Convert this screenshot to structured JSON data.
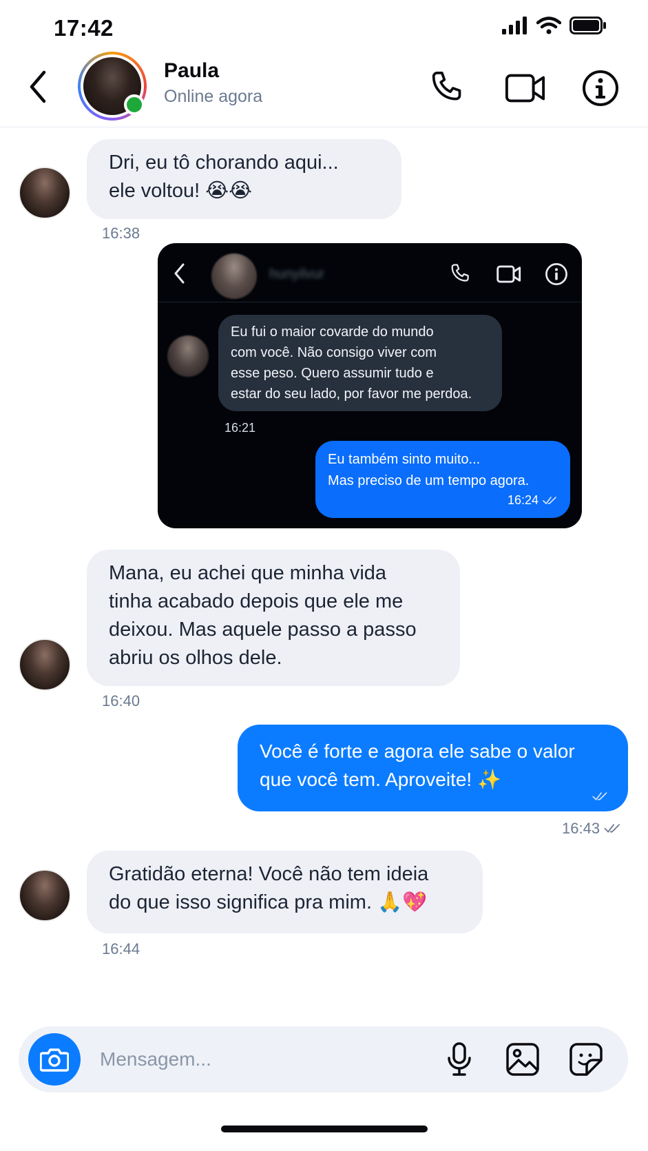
{
  "status_bar": {
    "time": "17:42"
  },
  "header": {
    "contact_name": "Paula",
    "contact_status": "Online agora"
  },
  "messages": [
    {
      "direction": "in",
      "lines": [
        "Dri, eu tô chorando aqui...",
        "ele voltou! 😭😭"
      ],
      "time": "16:38"
    },
    {
      "direction": "in",
      "lines": [
        "Mana, eu achei que minha vida",
        "tinha acabado depois que ele me",
        "deixou. Mas aquele passo a passo",
        "abriu os olhos dele."
      ],
      "time": "16:40"
    },
    {
      "direction": "out",
      "lines": [
        "Você é forte e agora ele sabe o valor",
        "que você tem. Aproveite! ✨"
      ],
      "time": "16:43"
    },
    {
      "direction": "in",
      "lines": [
        "Gratidão eterna! Você não tem ideia",
        "do que isso significa pra mim. 🙏💖"
      ],
      "time": "16:44"
    }
  ],
  "screenshot": {
    "contact_name": "hunyilvur",
    "incoming": {
      "lines": [
        "Eu fui o maior covarde do mundo",
        "com você. Não consigo viver com",
        "esse peso. Quero assumir tudo e",
        "estar do seu lado, por favor me perdoa."
      ],
      "time": "16:21"
    },
    "outgoing": {
      "lines": [
        "Eu também sinto muito...",
        "Mas preciso de um tempo agora."
      ],
      "time": "16:24"
    }
  },
  "input": {
    "placeholder": "Mensagem...",
    "value": ""
  },
  "colors": {
    "accent": "#0b7cff",
    "incoming_bubble": "#eef0f6",
    "online": "#1fa83a",
    "muted_text": "#6b7a90"
  },
  "icons": [
    "back-icon",
    "phone-icon",
    "video-icon",
    "info-icon",
    "camera-icon",
    "mic-icon",
    "image-icon",
    "sticker-icon",
    "double-check-icon"
  ]
}
